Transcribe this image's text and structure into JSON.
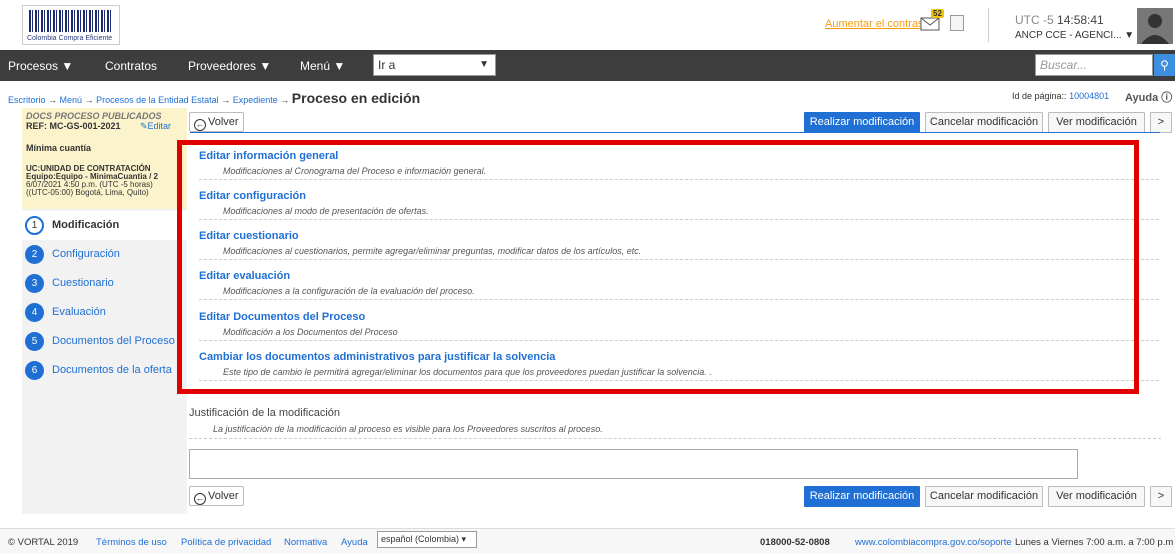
{
  "header": {
    "logo_text": "Colombia Compra Eficiente",
    "contrast_link": "Aumentar el contraste",
    "mail_count": "52",
    "timezone": "UTC -5",
    "time": "14:58:41",
    "agency": "ANCP CCE - AGENCI... ▼"
  },
  "nav": {
    "items": [
      "Procesos ▼",
      "Contratos",
      "Proveedores ▼",
      "Menú ▼"
    ],
    "goto_value": "Ir a",
    "search_placeholder": "Buscar..."
  },
  "breadcrumb": {
    "items": [
      "Escritorio",
      "Menú",
      "Procesos de la Entidad Estatal",
      "Expediente"
    ],
    "arrow": "→",
    "current": "Proceso en edición"
  },
  "page_id": {
    "label": "Id de página::",
    "value": "10004801"
  },
  "help_label": "Ayuda",
  "sidebar": {
    "status": "DOCS PROCESO PUBLICADOS",
    "ref": "REF: MC-GS-001-2021",
    "edit_label": "Editar",
    "type": "Mínima cuantía",
    "unit": "UC:UNIDAD DE CONTRATACIÓN",
    "team": "Equipo:Equipo - MinimaCuantia / 2",
    "date": "6/07/2021 4:50 p.m. (UTC -5 horas)",
    "zone": "((UTC-05:00) Bogotá, Lima, Quito)",
    "steps": [
      {
        "num": "1",
        "label": "Modificación"
      },
      {
        "num": "2",
        "label": "Configuración"
      },
      {
        "num": "3",
        "label": "Cuestionario"
      },
      {
        "num": "4",
        "label": "Evaluación"
      },
      {
        "num": "5",
        "label": "Documentos del Proceso"
      },
      {
        "num": "6",
        "label": "Documentos de la oferta"
      }
    ]
  },
  "actions": {
    "back": "Volver",
    "submit": "Realizar modificación",
    "cancel": "Cancelar modificación",
    "view": "Ver modificación",
    "more": ">"
  },
  "options": [
    {
      "title": "Editar información general",
      "desc": "Modificaciones al Cronograma del Proceso e información general."
    },
    {
      "title": "Editar configuración",
      "desc": "Modificaciones al modo de presentación de ofertas."
    },
    {
      "title": "Editar cuestionario",
      "desc": "Modificaciones al cuestionarios, permite agregar/eliminar preguntas, modificar datos de los artículos, etc."
    },
    {
      "title": "Editar evaluación",
      "desc": "Modificaciones a la configuración de la evaluación del proceso."
    },
    {
      "title": "Editar Documentos del Proceso",
      "desc": "Modificación a los Documentos del Proceso"
    },
    {
      "title": "Cambiar los documentos administrativos para justificar la solvencia",
      "desc": "Este tipo de cambio le permitirá agregar/eliminar los documentos para que los proveedores puedan justificar la solvencia. ."
    }
  ],
  "justification": {
    "title": "Justificación de la modificación",
    "desc": "La justificación de la modificación al proceso es visible para los Proveedores suscritos al proceso.",
    "value": ""
  },
  "footer": {
    "copyright": "© VORTAL 2019",
    "links": [
      "Términos de uso",
      "Política de privacidad",
      "Normativa",
      "Ayuda"
    ],
    "language": "español (Colombia) ▾",
    "phone": "018000-52-0808",
    "support_url": "www.colombiacompra.gov.co/soporte",
    "hours": "Lunes a Viernes 7:00 a.m. a 7:00 p.m"
  },
  "colors": {
    "accent": "#1f6fd4",
    "highlight": "#e00000",
    "navbar": "#3d3d3d"
  }
}
